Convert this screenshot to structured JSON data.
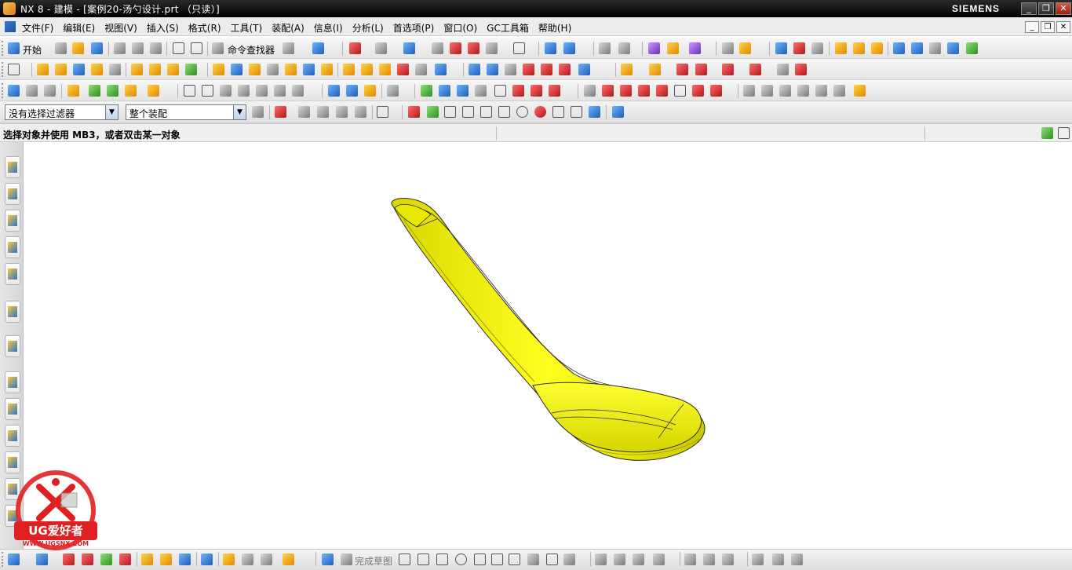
{
  "window": {
    "title": "NX 8 - 建模 - [案例20-汤勺设计.prt （只读）]",
    "brand": "SIEMENS",
    "controls": [
      "_",
      "❐",
      "✕"
    ]
  },
  "menubar": {
    "items": [
      "文件(F)",
      "编辑(E)",
      "视图(V)",
      "插入(S)",
      "格式(R)",
      "工具(T)",
      "装配(A)",
      "信息(I)",
      "分析(L)",
      "首选项(P)",
      "窗口(O)",
      "GC工具箱",
      "帮助(H)"
    ],
    "doc_controls": [
      "_",
      "❐",
      "✕"
    ]
  },
  "standard_toolbar": {
    "start_label": "开始",
    "command_finder_label": "命令查找器"
  },
  "selection_bar": {
    "filter_value": "没有选择过滤器",
    "scope_value": "整个装配"
  },
  "cue_line": {
    "text": "选择对象并使用 MB3，或者双击某一对象"
  },
  "sketch_toolbar": {
    "finish_sketch_label": "完成草图"
  },
  "watermark": {
    "brand_text": "UG爱好者",
    "url": "WWW.UGSNX.COM"
  },
  "colors": {
    "spoon_fill": "#f5f500",
    "spoon_shade": "#b8b800",
    "edge": "#2a2a2a",
    "watermark_red": "#e02020",
    "title_bar": "#000000"
  }
}
